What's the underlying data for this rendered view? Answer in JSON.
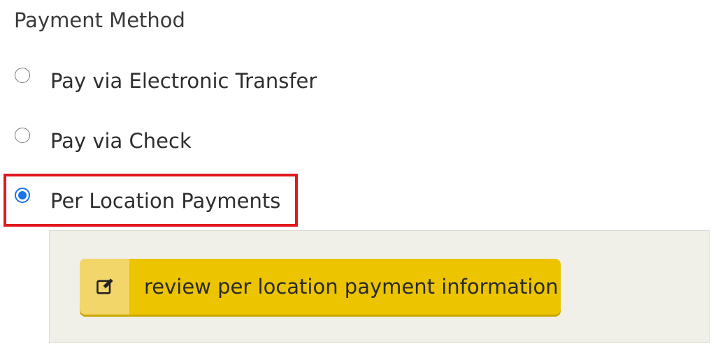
{
  "section": {
    "title": "Payment Method"
  },
  "options": [
    {
      "label": "Pay via Electronic Transfer",
      "selected": false
    },
    {
      "label": "Pay via Check",
      "selected": false
    },
    {
      "label": "Per Location Payments",
      "selected": true
    }
  ],
  "detail": {
    "review_button_label": "review per location payment information",
    "review_button_icon": "edit-icon"
  },
  "colors": {
    "accent": "#1a73e8",
    "button": "#ecc400",
    "highlight": "#e0191e",
    "panel": "#f0efe8"
  }
}
